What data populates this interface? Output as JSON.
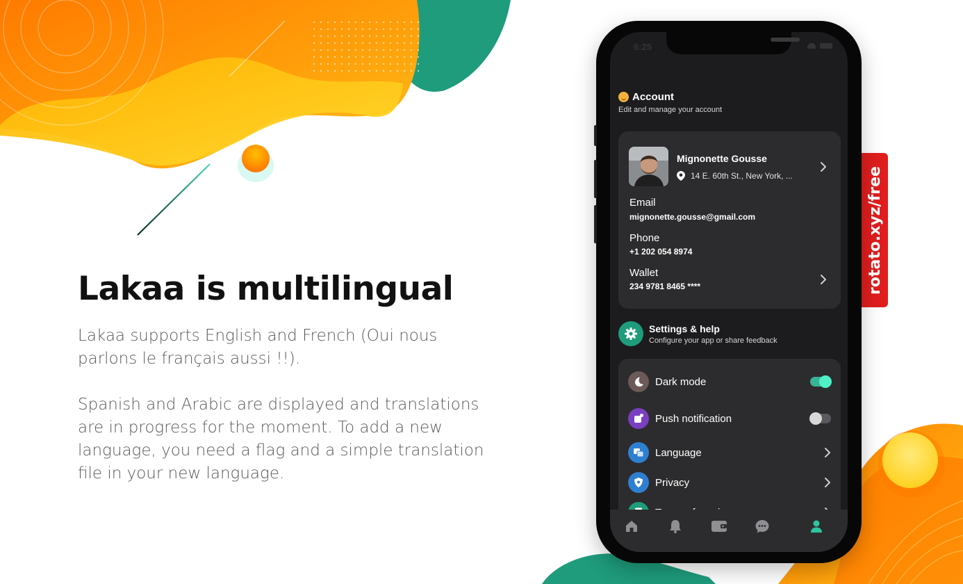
{
  "slide": {
    "headline": "Lakaa is multilingual",
    "paragraph_1": "Lakaa supports English and French (Oui nous parlons le français aussi !!).",
    "paragraph_2": "Spanish and Arabic are displayed and translations are in progress for the moment. To add a new language, you need a flag and a simple translation file in your new language."
  },
  "watermark": {
    "text": "rotato.xyz/free"
  },
  "colors": {
    "teal": "#1e9c7c",
    "orange": "#ff8a00",
    "yellow": "#ffd21f",
    "ribbon_red": "#e01e1e",
    "screen_bg": "#1c1c1e",
    "card_bg": "#2c2c2e"
  },
  "status_bar": {
    "time": "6:25"
  },
  "account": {
    "icon": "smiley-emoji-icon",
    "title": "Account",
    "subtitle": "Edit and manage your account",
    "profile": {
      "name": "Mignonette Gousse",
      "address": "14 E. 60th St., New York, ..."
    },
    "email": {
      "label": "Email",
      "value": "mignonette.gousse@gmail.com"
    },
    "phone": {
      "label": "Phone",
      "value": "+1 202 054  8974"
    },
    "wallet": {
      "label": "Wallet",
      "value": "234 9781 8465 ****"
    }
  },
  "settings": {
    "icon": "gear-icon",
    "title": "Settings & help",
    "subtitle": "Configure your app or share feedback",
    "items": [
      {
        "label": "Dark mode",
        "icon": "moon-icon",
        "control": "toggle",
        "on": true
      },
      {
        "label": "Push notification",
        "icon": "notification-icon",
        "control": "toggle",
        "on": false
      },
      {
        "label": "Language",
        "icon": "language-icon",
        "control": "chevron"
      },
      {
        "label": "Privacy",
        "icon": "shield-icon",
        "control": "chevron"
      },
      {
        "label": "Terms of service",
        "icon": "document-icon",
        "control": "chevron"
      }
    ]
  },
  "tab_bar": {
    "tabs": [
      {
        "icon": "home-icon",
        "active": false
      },
      {
        "icon": "bell-icon",
        "active": false
      },
      {
        "icon": "wallet-icon",
        "active": false
      },
      {
        "icon": "chat-icon",
        "active": false
      },
      {
        "icon": "profile-icon",
        "active": true
      }
    ]
  }
}
